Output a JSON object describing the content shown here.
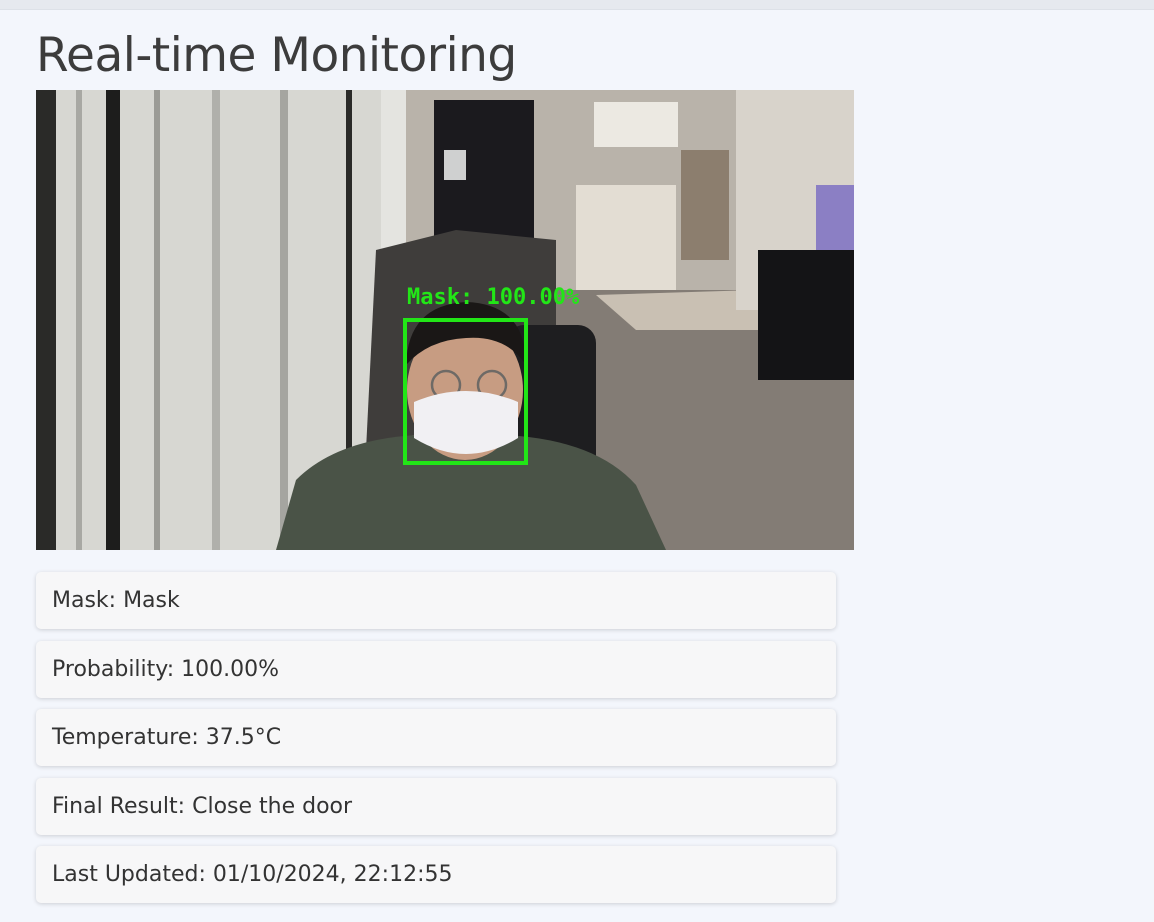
{
  "page": {
    "title": "Real-time Monitoring"
  },
  "video": {
    "overlay_label": "Mask: 100.00%",
    "box_color": "#22e617"
  },
  "info": [
    {
      "label": "Mask:",
      "value": "Mask"
    },
    {
      "label": "Probability:",
      "value": "100.00%"
    },
    {
      "label": "Temperature:",
      "value": "37.5°C"
    },
    {
      "label": "Final Result:",
      "value": "Close the door"
    },
    {
      "label": "Last Updated:",
      "value": "01/10/2024, 22:12:55"
    }
  ]
}
